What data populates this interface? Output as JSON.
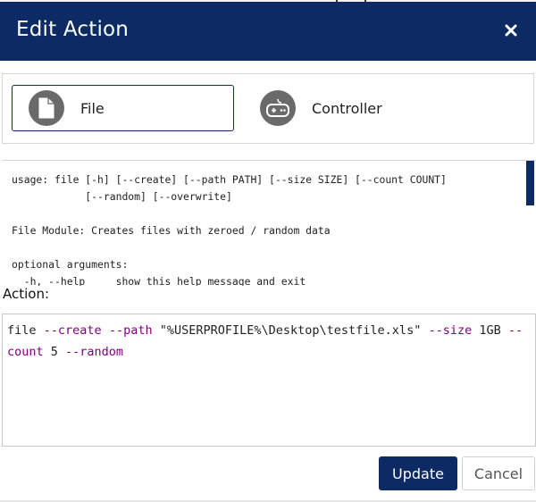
{
  "dialog": {
    "title": "Edit Action",
    "close_icon": "close-icon"
  },
  "modules": [
    {
      "label": "File",
      "icon": "file-icon",
      "selected": true
    },
    {
      "label": "Controller",
      "icon": "gamepad-icon",
      "selected": false
    }
  ],
  "help": {
    "lines": [
      "usage: file [-h] [--create] [--path PATH] [--size SIZE] [--count COUNT]",
      "            [--random] [--overwrite]",
      "",
      "File Module: Creates files with zeroed / random data",
      "",
      "optional arguments:",
      "  -h, --help     show this help message and exit"
    ]
  },
  "action": {
    "label": "Action:",
    "tokens": [
      {
        "text": "file ",
        "type": "cmd"
      },
      {
        "text": "--create",
        "type": "flag"
      },
      {
        "text": " ",
        "type": "cmd"
      },
      {
        "text": "--path",
        "type": "flag"
      },
      {
        "text": " \"%USERPROFILE%\\Desktop\\testfile.xls\" ",
        "type": "cmd"
      },
      {
        "text": "--size",
        "type": "flag"
      },
      {
        "text": " 1GB ",
        "type": "cmd"
      },
      {
        "text": "--count",
        "type": "flag"
      },
      {
        "text": " 5 ",
        "type": "cmd"
      },
      {
        "text": "--random",
        "type": "flag"
      }
    ]
  },
  "buttons": {
    "update": "Update",
    "cancel": "Cancel"
  },
  "colors": {
    "header_bg": "#0c2a63",
    "flag_color": "#800080",
    "icon_circle": "#6a6a6a"
  }
}
